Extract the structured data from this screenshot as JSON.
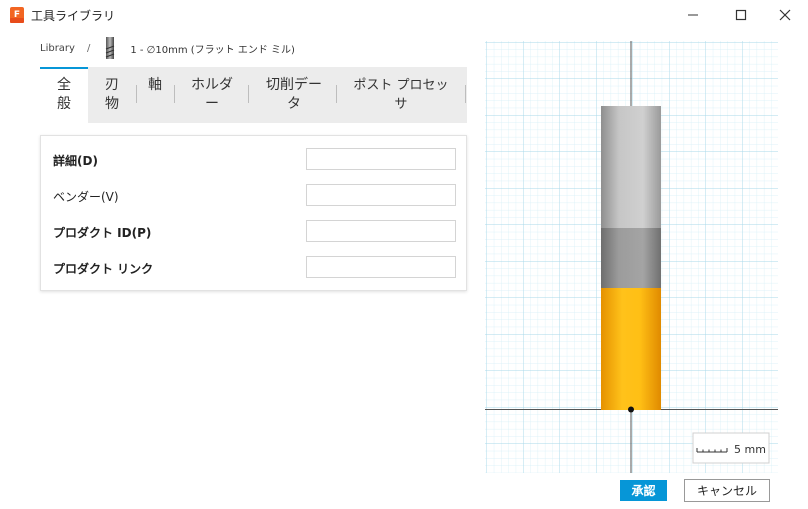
{
  "window": {
    "title": "工具ライブラリ",
    "app_icon": "fusion-app-icon",
    "controls": [
      "minimize-icon",
      "maximize-icon",
      "close-icon"
    ],
    "accent": "#0696d7"
  },
  "breadcrumb": {
    "library": "Library",
    "separator": "/",
    "tool_icon": "flat-end-mill-icon",
    "tool": "1 - ∅10mm (フラット エンド ミル)"
  },
  "tabs": [
    {
      "line1": "全",
      "line2": "般",
      "active": true
    },
    {
      "line1": "刃",
      "line2": "物",
      "active": false
    },
    {
      "line1": "軸",
      "line2": "",
      "active": false
    },
    {
      "line1": "ホルダ",
      "line2": "ー",
      "active": false
    },
    {
      "line1": "切削デー",
      "line2": "タ",
      "active": false
    },
    {
      "line1": "ポスト プロセッ",
      "line2": "サ",
      "active": false
    }
  ],
  "fields": [
    {
      "label": "詳細(D)",
      "value": ""
    },
    {
      "label": "ベンダー(V)",
      "value": ""
    },
    {
      "label": "プロダクト ID(P)",
      "value": ""
    },
    {
      "label": "プロダクト リンク",
      "value": ""
    }
  ],
  "preview": {
    "scale_label": "5 mm",
    "colors": {
      "grid": "#bfe3ef",
      "holder": "#c9c9c9",
      "shank": "#9a9a9a",
      "flutes": "#f5a800"
    }
  },
  "buttons": {
    "ok": "承認",
    "cancel": "キャンセル"
  }
}
